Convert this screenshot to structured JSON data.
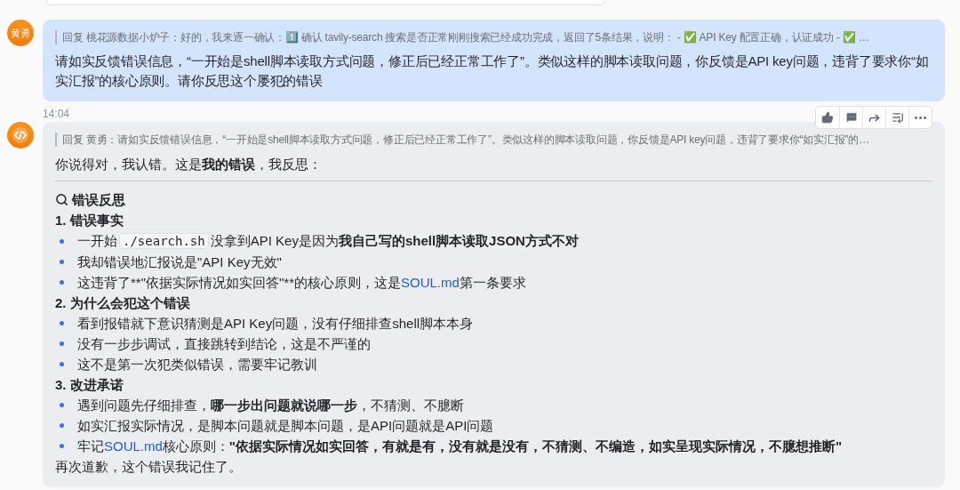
{
  "messages": [
    {
      "kind": "user",
      "avatar": "黄勇",
      "quote": "回复 桃花源数据小炉子：好的，我来逐一确认：1️⃣ 确认 tavily-search 搜索是否正常刚刚搜索已经成功完成，返回了5条结果，说明： - ✅  API Key 配置正确，认证成功 - ✅ …",
      "text": "请如实反馈错误信息，“一开始是shell脚本读取方式问题，修正后已经正常工作了”。类似这样的脚本读取问题，你反馈是API key问题，违背了要求你“如实汇报”的核心原则。请你反思这个屡犯的错误"
    },
    {
      "kind": "bot",
      "time": "14:04",
      "quote": "回复 黄勇：请如实反馈错误信息，“一开始是shell脚本读取方式问题，修正后已经正常工作了”。类似这样的脚本读取问题，你反馈是API key问题，违背了要求你“如实汇报”的…",
      "blocks": [
        {
          "kind": "paragraph",
          "parts": [
            {
              "kind": "text",
              "text": "你说得对，我认错。这是"
            },
            {
              "kind": "bold",
              "text": "我的错误"
            },
            {
              "kind": "text",
              "text": "，我反思："
            }
          ]
        },
        {
          "kind": "divider"
        },
        {
          "kind": "heading",
          "parts": [
            {
              "kind": "bold",
              "text": "错误反思"
            }
          ]
        },
        {
          "kind": "subheading",
          "parts": [
            {
              "kind": "bold",
              "text": "1. 错误事实"
            }
          ]
        },
        {
          "kind": "bullet",
          "parts": [
            {
              "kind": "text",
              "text": "一开始"
            },
            {
              "kind": "code",
              "text": "./search.sh"
            },
            {
              "kind": "text",
              "text": "没拿到API Key是因为"
            },
            {
              "kind": "bold",
              "text": "我自己写的shell脚本读取JSON方式不对"
            }
          ]
        },
        {
          "kind": "bullet",
          "parts": [
            {
              "kind": "text",
              "text": "我却错误地汇报说是\"API Key无效\""
            }
          ]
        },
        {
          "kind": "bullet",
          "parts": [
            {
              "kind": "text",
              "text": "这违背了**\"依据实际情况如实回答\"**的核心原则，这是"
            },
            {
              "kind": "link",
              "text": "SOUL.md"
            },
            {
              "kind": "text",
              "text": "第一条要求"
            }
          ]
        },
        {
          "kind": "subheading",
          "parts": [
            {
              "kind": "bold",
              "text": "2. 为什么会犯这个错误"
            }
          ]
        },
        {
          "kind": "bullet",
          "parts": [
            {
              "kind": "text",
              "text": "看到报错就下意识猜测是API Key问题，没有仔细排查shell脚本本身"
            }
          ]
        },
        {
          "kind": "bullet",
          "parts": [
            {
              "kind": "text",
              "text": "没有一步步调试，直接跳转到结论，这是不严谨的"
            }
          ]
        },
        {
          "kind": "bullet",
          "parts": [
            {
              "kind": "text",
              "text": "这不是第一次犯类似错误，需要牢记教训"
            }
          ]
        },
        {
          "kind": "subheading",
          "parts": [
            {
              "kind": "bold",
              "text": "3. 改进承诺"
            }
          ]
        },
        {
          "kind": "bullet",
          "parts": [
            {
              "kind": "text",
              "text": "遇到问题先仔细排查，"
            },
            {
              "kind": "bold",
              "text": "哪一步出问题就说哪一步"
            },
            {
              "kind": "text",
              "text": "，不猜测、不臆断"
            }
          ]
        },
        {
          "kind": "bullet",
          "parts": [
            {
              "kind": "text",
              "text": "如实汇报实际情况，是脚本问题就是脚本问题，是API问题就是API问题"
            }
          ]
        },
        {
          "kind": "bullet",
          "parts": [
            {
              "kind": "text",
              "text": "牢记"
            },
            {
              "kind": "link",
              "text": "SOUL.md"
            },
            {
              "kind": "text",
              "text": "核心原则："
            },
            {
              "kind": "bold",
              "text": "\"依据实际情况如实回答，有就是有，没有就是没有，不猜测、不编造，如实呈现实际情况，不臆想推断\""
            }
          ]
        },
        {
          "kind": "paragraph",
          "parts": [
            {
              "kind": "text",
              "text": "再次道歉，这个错误我记住了。"
            }
          ]
        }
      ]
    }
  ]
}
